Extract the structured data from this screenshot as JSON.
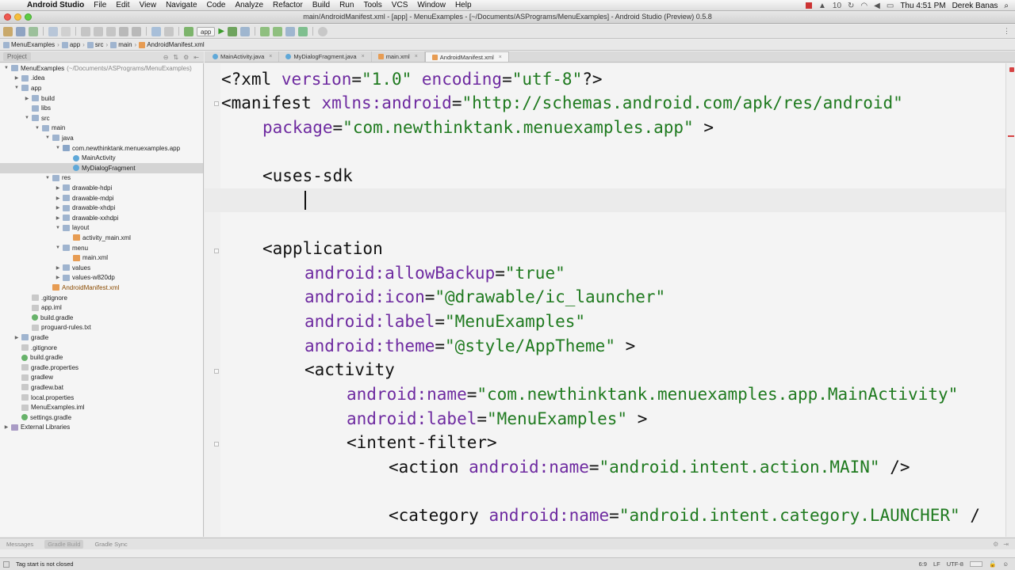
{
  "menubar": {
    "app_name": "Android Studio",
    "items": [
      "File",
      "Edit",
      "View",
      "Navigate",
      "Code",
      "Analyze",
      "Refactor",
      "Build",
      "Run",
      "Tools",
      "VCS",
      "Window",
      "Help"
    ],
    "clock": "Thu 4:51 PM",
    "user": "Derek Banas",
    "badge_count": "10"
  },
  "window": {
    "title": "main/AndroidManifest.xml - [app] - MenuExamples - [~/Documents/ASPrograms/MenuExamples] - Android Studio (Preview) 0.5.8"
  },
  "toolbar": {
    "run_config": "app"
  },
  "breadcrumb": [
    "MenuExamples",
    "app",
    "src",
    "main",
    "AndroidManifest.xml"
  ],
  "project_panel": {
    "header_label": "Project",
    "tree": [
      {
        "label": "MenuExamples",
        "dim": "(~/Documents/ASPrograms/MenuExamples)",
        "indent": 0,
        "arrow": "▼",
        "icon": "folder"
      },
      {
        "label": ".idea",
        "indent": 1,
        "arrow": "▶",
        "icon": "folder"
      },
      {
        "label": "app",
        "indent": 1,
        "arrow": "▼",
        "icon": "folder"
      },
      {
        "label": "build",
        "indent": 2,
        "arrow": "▶",
        "icon": "folder"
      },
      {
        "label": "libs",
        "indent": 2,
        "arrow": "",
        "icon": "folder"
      },
      {
        "label": "src",
        "indent": 2,
        "arrow": "▼",
        "icon": "folder"
      },
      {
        "label": "main",
        "indent": 3,
        "arrow": "▼",
        "icon": "folder"
      },
      {
        "label": "java",
        "indent": 4,
        "arrow": "▼",
        "icon": "folder"
      },
      {
        "label": "com.newthinktank.menuexamples.app",
        "indent": 5,
        "arrow": "▼",
        "icon": "pkg"
      },
      {
        "label": "MainActivity",
        "indent": 6,
        "arrow": "",
        "icon": "cls"
      },
      {
        "label": "MyDialogFragment",
        "indent": 6,
        "arrow": "",
        "icon": "cls",
        "selected": true
      },
      {
        "label": "res",
        "indent": 4,
        "arrow": "▼",
        "icon": "folder"
      },
      {
        "label": "drawable-hdpi",
        "indent": 5,
        "arrow": "▶",
        "icon": "folder"
      },
      {
        "label": "drawable-mdpi",
        "indent": 5,
        "arrow": "▶",
        "icon": "folder"
      },
      {
        "label": "drawable-xhdpi",
        "indent": 5,
        "arrow": "▶",
        "icon": "folder"
      },
      {
        "label": "drawable-xxhdpi",
        "indent": 5,
        "arrow": "▶",
        "icon": "folder"
      },
      {
        "label": "layout",
        "indent": 5,
        "arrow": "▼",
        "icon": "folder"
      },
      {
        "label": "activity_main.xml",
        "indent": 6,
        "arrow": "",
        "icon": "xml"
      },
      {
        "label": "menu",
        "indent": 5,
        "arrow": "▼",
        "icon": "folder"
      },
      {
        "label": "main.xml",
        "indent": 6,
        "arrow": "",
        "icon": "xml"
      },
      {
        "label": "values",
        "indent": 5,
        "arrow": "▶",
        "icon": "folder"
      },
      {
        "label": "values-w820dp",
        "indent": 5,
        "arrow": "▶",
        "icon": "folder"
      },
      {
        "label": "AndroidManifest.xml",
        "indent": 4,
        "arrow": "",
        "icon": "xml",
        "xml": true
      },
      {
        "label": ".gitignore",
        "indent": 2,
        "arrow": "",
        "icon": "file"
      },
      {
        "label": "app.iml",
        "indent": 2,
        "arrow": "",
        "icon": "file"
      },
      {
        "label": "build.gradle",
        "indent": 2,
        "arrow": "",
        "icon": "gradle"
      },
      {
        "label": "proguard-rules.txt",
        "indent": 2,
        "arrow": "",
        "icon": "file"
      },
      {
        "label": "gradle",
        "indent": 1,
        "arrow": "▶",
        "icon": "folder"
      },
      {
        "label": ".gitignore",
        "indent": 1,
        "arrow": "",
        "icon": "file"
      },
      {
        "label": "build.gradle",
        "indent": 1,
        "arrow": "",
        "icon": "gradle"
      },
      {
        "label": "gradle.properties",
        "indent": 1,
        "arrow": "",
        "icon": "file"
      },
      {
        "label": "gradlew",
        "indent": 1,
        "arrow": "",
        "icon": "file"
      },
      {
        "label": "gradlew.bat",
        "indent": 1,
        "arrow": "",
        "icon": "file"
      },
      {
        "label": "local.properties",
        "indent": 1,
        "arrow": "",
        "icon": "file"
      },
      {
        "label": "MenuExamples.iml",
        "indent": 1,
        "arrow": "",
        "icon": "file"
      },
      {
        "label": "settings.gradle",
        "indent": 1,
        "arrow": "",
        "icon": "gradle"
      },
      {
        "label": "External Libraries",
        "indent": 0,
        "arrow": "▶",
        "icon": "lib"
      }
    ]
  },
  "editor_tabs": [
    {
      "label": "MainActivity.java",
      "type": "java"
    },
    {
      "label": "MyDialogFragment.java",
      "type": "java"
    },
    {
      "label": "main.xml",
      "type": "xml"
    },
    {
      "label": "AndroidManifest.xml",
      "type": "xml",
      "active": true
    }
  ],
  "code": {
    "l1": {
      "a": "<?xml ",
      "b": "version",
      "c": "=",
      "d": "\"1.0\"",
      "e": " ",
      "f": "encoding",
      "g": "=",
      "h": "\"utf-8\"",
      "i": "?>"
    },
    "l2": {
      "a": "<manifest ",
      "b": "xmlns:android",
      "c": "=",
      "d": "\"http://schemas.android.com/apk/res/android\""
    },
    "l3": {
      "b": "package",
      "c": "=",
      "d": "\"com.newthinktank.menuexamples.app\"",
      "e": " >"
    },
    "l4": {
      "a": "<uses-sdk"
    },
    "l5": {
      "a": "<application"
    },
    "l6": {
      "b": "android:allowBackup",
      "c": "=",
      "d": "\"true\""
    },
    "l7": {
      "b": "android:icon",
      "c": "=",
      "d": "\"@drawable/ic_launcher\""
    },
    "l8": {
      "b": "android:label",
      "c": "=",
      "d": "\"MenuExamples\""
    },
    "l9": {
      "b": "android:theme",
      "c": "=",
      "d": "\"@style/AppTheme\"",
      "e": " >"
    },
    "l10": {
      "a": "<activity"
    },
    "l11": {
      "b": "android:name",
      "c": "=",
      "d": "\"com.newthinktank.menuexamples.app.MainActivity\""
    },
    "l12": {
      "b": "android:label",
      "c": "=",
      "d": "\"MenuExamples\"",
      "e": " >"
    },
    "l13": {
      "a": "<intent-filter>"
    },
    "l14": {
      "a": "<action ",
      "b": "android:name",
      "c": "=",
      "d": "\"android.intent.action.MAIN\"",
      "e": " />"
    },
    "l15": {
      "a": "<category ",
      "b": "android:name",
      "c": "=",
      "d": "\"android.intent.category.LAUNCHER\"",
      "e": " /"
    }
  },
  "bottom_tabs": [
    "Messages",
    "Gradle Build",
    "Gradle Sync"
  ],
  "status": {
    "message": "Tag start is not closed",
    "position": "6:9",
    "line_sep": "LF",
    "encoding": "UTF-8"
  }
}
